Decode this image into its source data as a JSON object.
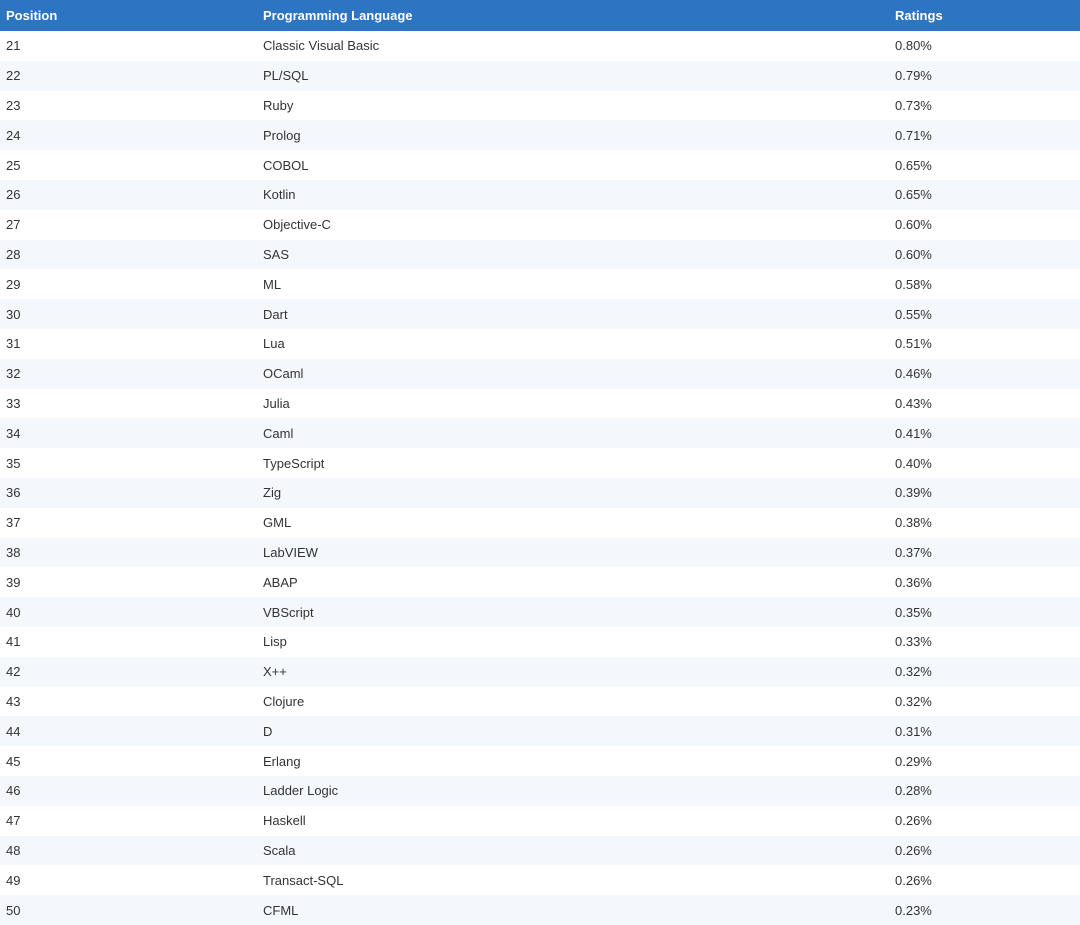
{
  "table": {
    "headers": {
      "position": "Position",
      "language": "Programming Language",
      "ratings": "Ratings"
    },
    "rows": [
      {
        "position": "21",
        "language": "Classic Visual Basic",
        "rating": "0.80%"
      },
      {
        "position": "22",
        "language": "PL/SQL",
        "rating": "0.79%"
      },
      {
        "position": "23",
        "language": "Ruby",
        "rating": "0.73%"
      },
      {
        "position": "24",
        "language": "Prolog",
        "rating": "0.71%"
      },
      {
        "position": "25",
        "language": "COBOL",
        "rating": "0.65%"
      },
      {
        "position": "26",
        "language": "Kotlin",
        "rating": "0.65%"
      },
      {
        "position": "27",
        "language": "Objective-C",
        "rating": "0.60%"
      },
      {
        "position": "28",
        "language": "SAS",
        "rating": "0.60%"
      },
      {
        "position": "29",
        "language": "ML",
        "rating": "0.58%"
      },
      {
        "position": "30",
        "language": "Dart",
        "rating": "0.55%"
      },
      {
        "position": "31",
        "language": "Lua",
        "rating": "0.51%"
      },
      {
        "position": "32",
        "language": "OCaml",
        "rating": "0.46%"
      },
      {
        "position": "33",
        "language": "Julia",
        "rating": "0.43%"
      },
      {
        "position": "34",
        "language": "Caml",
        "rating": "0.41%"
      },
      {
        "position": "35",
        "language": "TypeScript",
        "rating": "0.40%"
      },
      {
        "position": "36",
        "language": "Zig",
        "rating": "0.39%"
      },
      {
        "position": "37",
        "language": "GML",
        "rating": "0.38%"
      },
      {
        "position": "38",
        "language": "LabVIEW",
        "rating": "0.37%"
      },
      {
        "position": "39",
        "language": "ABAP",
        "rating": "0.36%"
      },
      {
        "position": "40",
        "language": "VBScript",
        "rating": "0.35%"
      },
      {
        "position": "41",
        "language": "Lisp",
        "rating": "0.33%"
      },
      {
        "position": "42",
        "language": "X++",
        "rating": "0.32%"
      },
      {
        "position": "43",
        "language": "Clojure",
        "rating": "0.32%"
      },
      {
        "position": "44",
        "language": "D",
        "rating": "0.31%"
      },
      {
        "position": "45",
        "language": "Erlang",
        "rating": "0.29%"
      },
      {
        "position": "46",
        "language": "Ladder Logic",
        "rating": "0.28%"
      },
      {
        "position": "47",
        "language": "Haskell",
        "rating": "0.26%"
      },
      {
        "position": "48",
        "language": "Scala",
        "rating": "0.26%"
      },
      {
        "position": "49",
        "language": "Transact-SQL",
        "rating": "0.26%"
      },
      {
        "position": "50",
        "language": "CFML",
        "rating": "0.23%"
      }
    ]
  },
  "colors": {
    "header_background": "#2d74c3",
    "header_text": "#ffffff",
    "row_stripe": "#f4f8fc",
    "row_text": "#333333"
  }
}
